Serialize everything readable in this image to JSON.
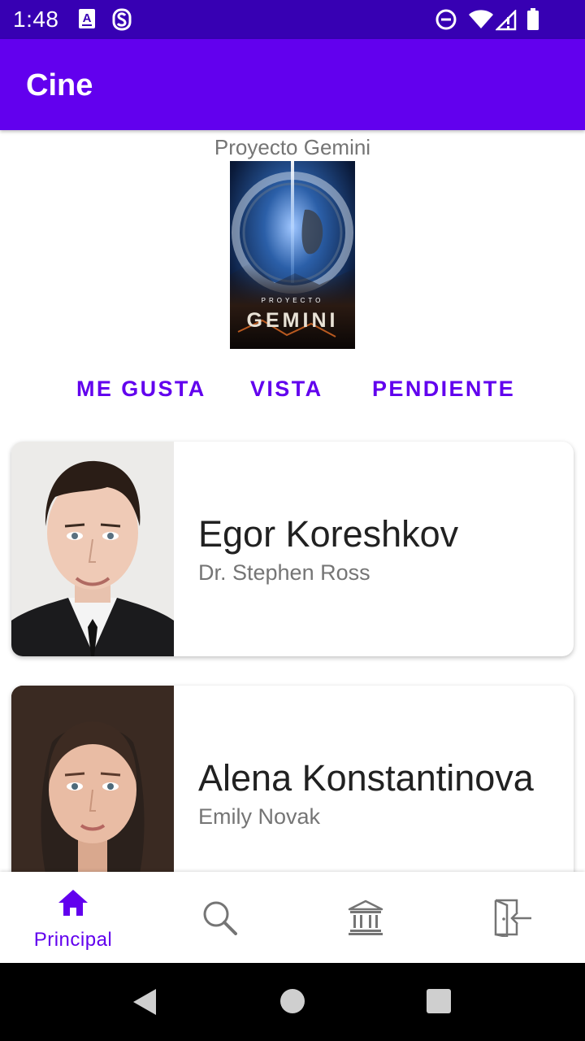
{
  "status_bar": {
    "time": "1:48",
    "left_icons": [
      "keyboard-a-icon",
      "s-notification-icon"
    ],
    "right_icons": [
      "do-not-disturb-icon",
      "wifi-icon",
      "signal-icon",
      "battery-icon"
    ]
  },
  "app_bar": {
    "title": "Cine"
  },
  "movie": {
    "title": "Proyecto Gemini",
    "poster_text_top": "PROYECTO",
    "poster_text_main": "GEMINI"
  },
  "actions": {
    "like": "ME GUSTA",
    "watched": "VISTA",
    "pending": "PENDIENTE"
  },
  "cast": [
    {
      "actor": "Egor Koreshkov",
      "character": "Dr. Stephen Ross"
    },
    {
      "actor": "Alena Konstantinova",
      "character": "Emily Novak"
    }
  ],
  "bottom_nav": {
    "items": [
      {
        "icon": "home-icon",
        "label": "Principal",
        "selected": true
      },
      {
        "icon": "search-icon",
        "label": "",
        "selected": false
      },
      {
        "icon": "institution-icon",
        "label": "",
        "selected": false
      },
      {
        "icon": "logout-icon",
        "label": "",
        "selected": false
      }
    ]
  },
  "colors": {
    "primary": "#6200ee",
    "primary_dark": "#3700b3",
    "text_primary": "#212121",
    "text_secondary": "#757575",
    "icon_inactive": "#757575"
  }
}
